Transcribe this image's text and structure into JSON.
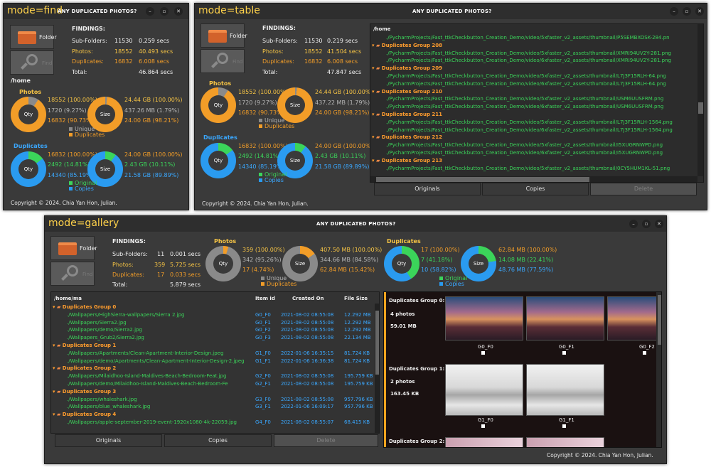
{
  "find": {
    "mode": "mode=find",
    "title": "ANY DUPLICATED PHOTOS?",
    "folder_btn": "Folder",
    "find_btn": "Find",
    "findings": "FINDINGS:",
    "stats": [
      {
        "label": "Sub-Folders:",
        "count": "11530",
        "time": "0.259 secs"
      },
      {
        "label": "Photos:",
        "count": "18552",
        "time": "40.493 secs"
      },
      {
        "label": "Duplicates:",
        "count": "16832",
        "time": "6.008 secs"
      },
      {
        "label": "Total:",
        "count": "",
        "time": "46.864 secs"
      }
    ],
    "path": "/home",
    "photos_title": "Photos",
    "photos_qty": [
      "18552  (100.00%)",
      "1720  (9.27%)",
      "16832  (90.73%)"
    ],
    "photos_size": [
      "24.44 GB  (100.00%)",
      "437.26 MB  (1.79%)",
      "24.00 GB  (98.21%)"
    ],
    "photos_legend": [
      "Unique",
      "Duplicates"
    ],
    "dup_title": "Duplicates",
    "dup_qty": [
      "16832  (100.00%)",
      "2492  (14.81%)",
      "14340  (85.19%)"
    ],
    "dup_size": [
      "24.00 GB  (100.00%)",
      "2.43 GB  (10.11%)",
      "21.58 GB  (89.89%)"
    ],
    "dup_legend": [
      "Original",
      "Copies"
    ],
    "qty_label": "Qty",
    "size_label": "Size",
    "copyright": "Copyright © 2024. Chia Yan Hon, Julian."
  },
  "table": {
    "mode": "mode=table",
    "title": "ANY DUPLICATED PHOTOS?",
    "folder_btn": "Folder",
    "find_btn": "Find",
    "findings": "FINDINGS:",
    "stats": [
      {
        "label": "Sub-Folders:",
        "count": "11530",
        "time": "0.219 secs"
      },
      {
        "label": "Photos:",
        "count": "18552",
        "time": "41.504 secs"
      },
      {
        "label": "Duplicates:",
        "count": "16832",
        "time": "6.008 secs"
      },
      {
        "label": "Total:",
        "count": "",
        "time": "47.847 secs"
      }
    ],
    "photos_title": "Photos",
    "photos_qty": [
      "18552  (100.00%)",
      "1720  (9.27%)",
      "16832  (90.73%)"
    ],
    "photos_size": [
      "24.44 GB  (100.00%)",
      "437.22 MB  (1.79%)",
      "24.00 GB  (98.21%)"
    ],
    "photos_legend": [
      "Unique",
      "Duplicates"
    ],
    "dup_title": "Duplicates",
    "dup_qty": [
      "16832  (100.00%)",
      "2492  (14.81%)",
      "14340  (85.19%)"
    ],
    "dup_size": [
      "24.00 GB  (100.00%)",
      "2.43 GB  (10.11%)",
      "21.58 GB  (89.89%)"
    ],
    "dup_legend": [
      "Original",
      "Copies"
    ],
    "qty_label": "Qty",
    "size_label": "Size",
    "tree_root": "/home",
    "rows": [
      {
        "t": "p",
        "v": "./PycharmProjects/Fast_ttkCheckbutton_Creation_Demo/video/5xfaster_v2_assets/thumbnail/P5SEMBXOSK-284.pn"
      },
      {
        "t": "g",
        "v": "Duplicates Group 208"
      },
      {
        "t": "p",
        "v": "./PycharmProjects/Fast_ttkCheckbutton_Creation_Demo/video/5xfaster_v2_assets/thumbnail/XMRI94UV2Y-281.png"
      },
      {
        "t": "p",
        "v": "./PycharmProjects/Fast_ttkCheckbutton_Creation_Demo/video/6xfaster_v2_assets/thumbnail/XMRI94UV2Y-281.png"
      },
      {
        "t": "g",
        "v": "Duplicates Group 209"
      },
      {
        "t": "p",
        "v": "./PycharmProjects/Fast_ttkCheckbutton_Creation_Demo/video/5xfaster_v2_assets/thumbnail/L7J3F15RLH-64.png"
      },
      {
        "t": "p",
        "v": "./PycharmProjects/Fast_ttkCheckbutton_Creation_Demo/video/6xfaster_v2_assets/thumbnail/L7J3F15RLH-64.png"
      },
      {
        "t": "g",
        "v": "Duplicates Group 210"
      },
      {
        "t": "p",
        "v": "./PycharmProjects/Fast_ttkCheckbutton_Creation_Demo/video/5xfaster_v2_assets/thumbnail/USM6UUSFRM.png"
      },
      {
        "t": "p",
        "v": "./PycharmProjects/Fast_ttkCheckbutton_Creation_Demo/video/6xfaster_v2_assets/thumbnail/USM6UUSFRM.png"
      },
      {
        "t": "g",
        "v": "Duplicates Group 211"
      },
      {
        "t": "p",
        "v": "./PycharmProjects/Fast_ttkCheckbutton_Creation_Demo/video/5xfaster_v2_assets/thumbnail/L7J3F15RLH-1564.png"
      },
      {
        "t": "p",
        "v": "./PycharmProjects/Fast_ttkCheckbutton_Creation_Demo/video/6xfaster_v2_assets/thumbnail/L7J3F15RLH-1564.png"
      },
      {
        "t": "g",
        "v": "Duplicates Group 212"
      },
      {
        "t": "p",
        "v": "./PycharmProjects/Fast_ttkCheckbutton_Creation_Demo/video/5xfaster_v2_assets/thumbnail/I5XUGRNWPD.png"
      },
      {
        "t": "p",
        "v": "./PycharmProjects/Fast_ttkCheckbutton_Creation_Demo/video/6xfaster_v2_assets/thumbnail/I5XUGRNWPD.png"
      },
      {
        "t": "g",
        "v": "Duplicates Group 213"
      },
      {
        "t": "p",
        "v": "./PycharmProjects/Fast_ttkCheckbutton_Creation_Demo/video/5xfaster_v2_assets/thumbnail/0CY5HUM1KL-51.png"
      }
    ],
    "tabs": [
      "Originals",
      "Copies",
      "Delete"
    ],
    "copyright": "Copyright © 2024. Chia Yan Hon, Julian."
  },
  "gallery": {
    "mode": "mode=gallery",
    "title": "ANY DUPLICATED PHOTOS?",
    "folder_btn": "Folder",
    "find_btn": "Find",
    "findings": "FINDINGS:",
    "stats": [
      {
        "label": "Sub-Folders:",
        "count": "11",
        "time": "0.001 secs"
      },
      {
        "label": "Photos:",
        "count": "359",
        "time": "5.725 secs"
      },
      {
        "label": "Duplicates:",
        "count": "17",
        "time": "0.033 secs"
      },
      {
        "label": "Total:",
        "count": "",
        "time": "5.879 secs"
      }
    ],
    "photos_title": "Photos",
    "photos_qty": [
      "359  (100.00%)",
      "342  (95.26%)",
      "17  (4.74%)"
    ],
    "photos_size": [
      "407.50 MB  (100.00%)",
      "344.66 MB  (84.58%)",
      "62.84 MB  (15.42%)"
    ],
    "photos_legend": [
      "Unique",
      "Duplicates"
    ],
    "dup_title": "Duplicates",
    "dup_qty": [
      "17  (100.00%)",
      "7  (41.18%)",
      "10  (58.82%)"
    ],
    "dup_size": [
      "62.84 MB  (100.00%)",
      "14.08 MB  (22.41%)",
      "48.76 MB  (77.59%)"
    ],
    "dup_legend": [
      "Original",
      "Copies"
    ],
    "qty_label": "Qty",
    "size_label": "Size",
    "headers": [
      "/home/ma",
      "Item id",
      "Created On",
      "File Size"
    ],
    "rows": [
      {
        "t": "g",
        "v": "Duplicates Group 0",
        "id": "",
        "date": "",
        "size": ""
      },
      {
        "t": "p",
        "v": "./Wallpapers/HighSierra-wallpapers/Sierra 2.jpg",
        "id": "G0_F0",
        "date": "2021-08-02 08:55:08",
        "size": "12.292 MB"
      },
      {
        "t": "p",
        "v": "./Wallpapers/Sierra2.jpg",
        "id": "G0_F1",
        "date": "2021-08-02 08:55:08",
        "size": "12.292 MB"
      },
      {
        "t": "p",
        "v": "./Wallpapers/demo/Sierra2.jpg",
        "id": "G0_F2",
        "date": "2021-08-02 08:55:08",
        "size": "12.292 MB"
      },
      {
        "t": "p",
        "v": "./Wallpapers_Grub2/Sierra2.jpg",
        "id": "G0_F3",
        "date": "2021-08-02 08:55:08",
        "size": "22.134 MB"
      },
      {
        "t": "g",
        "v": "Duplicates Group 1",
        "id": "",
        "date": "",
        "size": ""
      },
      {
        "t": "p",
        "v": "./Wallpapers/Apartments/Clean-Apartment-Interior-Design.jpeg",
        "id": "G1_F0",
        "date": "2022-01-06 16:35:15",
        "size": "81.724 KB"
      },
      {
        "t": "p",
        "v": "./Wallpapers/demo/Apartments/Clean-Apartment-Interior-Design-2.jpeg",
        "id": "G1_F1",
        "date": "2022-01-06 16:36:38",
        "size": "81.724 KB"
      },
      {
        "t": "g",
        "v": "Duplicates Group 2",
        "id": "",
        "date": "",
        "size": ""
      },
      {
        "t": "p",
        "v": "./Wallpapers/Milaidhoo-Island-Maldives-Beach-Bedroom-Feat.jpg",
        "id": "G2_F0",
        "date": "2021-08-02 08:55:08",
        "size": "195.759 KB"
      },
      {
        "t": "p",
        "v": "./Wallpapers/demo/Milaidhoo-Island-Maldives-Beach-Bedroom-Fe",
        "id": "G2_F1",
        "date": "2021-08-02 08:55:08",
        "size": "195.759 KB"
      },
      {
        "t": "g",
        "v": "Duplicates Group 3",
        "id": "",
        "date": "",
        "size": ""
      },
      {
        "t": "p",
        "v": "./Wallpapers/whaleshark.jpg",
        "id": "G3_F0",
        "date": "2021-08-02 08:55:08",
        "size": "957.796 KB"
      },
      {
        "t": "p",
        "v": "./Wallpapers/blue_whaleshark.jpg",
        "id": "G3_F1",
        "date": "2022-01-06 16:09:17",
        "size": "957.796 KB"
      },
      {
        "t": "g",
        "v": "Duplicates Group 4",
        "id": "",
        "date": "",
        "size": ""
      },
      {
        "t": "p",
        "v": "./Wallpapers/apple-september-2019-event-1920x1080-4k-22059.jpg",
        "id": "G4_F0",
        "date": "2021-08-02 08:55:07",
        "size": "68.415 KB"
      }
    ],
    "tabs": [
      "Originals",
      "Copies",
      "Delete"
    ],
    "groups": [
      {
        "title": "Duplicates Group 0:",
        "photos": "4 photos",
        "size": "59.01 MB",
        "items": [
          "G0_F0",
          "G0_F1",
          "G0_F2"
        ]
      },
      {
        "title": "Duplicates Group 1:",
        "photos": "2 photos",
        "size": "163.45 KB",
        "items": [
          "G1_F0",
          "G1_F1"
        ]
      },
      {
        "title": "Duplicates Group 2:",
        "photos": "",
        "size": "",
        "items": []
      }
    ],
    "copyright": "Copyright © 2024. Chia Yan Hon, Julian."
  },
  "colors": {
    "unique": "#8a8a8a",
    "duplicates": "#f29d28",
    "original": "#3bd45a",
    "copies": "#2a9bf0",
    "accent": "#ffd24a"
  }
}
